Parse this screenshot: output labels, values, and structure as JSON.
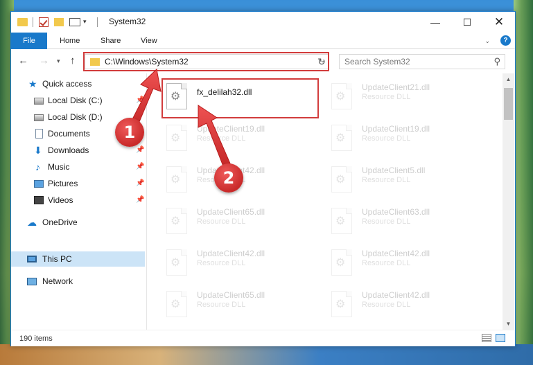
{
  "window": {
    "title": "System32",
    "minimize_glyph": "—",
    "maximize_glyph": "☐",
    "close_glyph": "✕"
  },
  "quick_access_toolbar": {
    "dropdown_glyph": "▾"
  },
  "ribbon": {
    "tabs": [
      "File",
      "Home",
      "Share",
      "View"
    ],
    "expand_glyph": "⌄",
    "help_glyph": "?"
  },
  "navigation": {
    "back_glyph": "←",
    "forward_glyph": "→",
    "recent_glyph": "▾",
    "up_glyph": "↑",
    "address": "C:\\Windows\\System32",
    "address_dropdown_glyph": "⌄",
    "refresh_glyph": "↻",
    "search_placeholder": "Search System32",
    "search_glyph": "⚲"
  },
  "nav_pane": {
    "items": [
      {
        "label": "Quick access",
        "icon": "star-icon",
        "glyph": "★"
      },
      {
        "label": "Local Disk (C:)",
        "icon": "disk-icon",
        "pinned": true
      },
      {
        "label": "Local Disk (D:)",
        "icon": "disk-icon"
      },
      {
        "label": "Documents",
        "icon": "documents-icon",
        "pinned": true
      },
      {
        "label": "Downloads",
        "icon": "download-icon",
        "glyph": "⬇",
        "pinned": true
      },
      {
        "label": "Music",
        "icon": "music-icon",
        "glyph": "♪",
        "pinned": true
      },
      {
        "label": "Pictures",
        "icon": "pictures-icon",
        "pinned": true
      },
      {
        "label": "Videos",
        "icon": "videos-icon",
        "pinned": true
      },
      {
        "label": "OneDrive",
        "icon": "cloud-icon",
        "glyph": "☁"
      },
      {
        "label": "This PC",
        "icon": "computer-icon",
        "selected": true
      },
      {
        "label": "Network",
        "icon": "network-icon"
      }
    ],
    "pin_glyph": "📌"
  },
  "files": [
    {
      "name": "fx_delilah32.dll",
      "type": ""
    },
    {
      "name": "UpdateClient21.dll",
      "type": "Resource DLL"
    },
    {
      "name": "UpdateClient19.dll",
      "type": "Resource DLL"
    },
    {
      "name": "UpdateClient19.dll",
      "type": "Resource DLL"
    },
    {
      "name": "UpdateClient42.dll",
      "type": "Resource DLL"
    },
    {
      "name": "UpdateClient5.dll",
      "type": "Resource DLL"
    },
    {
      "name": "UpdateClient65.dll",
      "type": "Resource DLL"
    },
    {
      "name": "UpdateClient63.dll",
      "type": "Resource DLL"
    },
    {
      "name": "UpdateClient42.dll",
      "type": "Resource DLL"
    },
    {
      "name": "UpdateClient42.dll",
      "type": "Resource DLL"
    },
    {
      "name": "UpdateClient65.dll",
      "type": "Resource DLL"
    },
    {
      "name": "UpdateClient42.dll",
      "type": "Resource DLL"
    }
  ],
  "scrollbar": {
    "up_glyph": "▲",
    "down_glyph": "▼"
  },
  "status": {
    "item_count": "190 items"
  },
  "annotations": {
    "step1": "1",
    "step2": "2",
    "color": "#d23c3c"
  },
  "colors": {
    "accent": "#1979ca",
    "selection": "#cce4f7"
  }
}
